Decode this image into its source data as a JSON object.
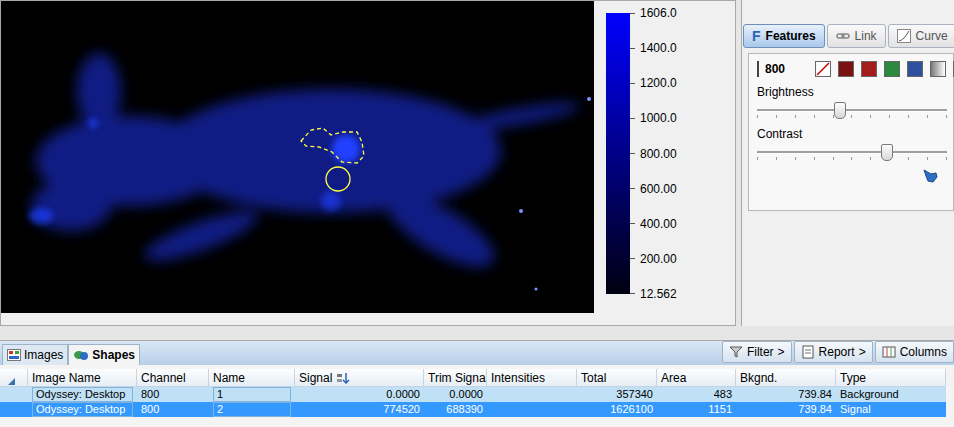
{
  "viewer": {
    "scale": {
      "labels": [
        "1606.0",
        "1400.0",
        "1200.0",
        "1000.0",
        "800.00",
        "600.00",
        "400.00",
        "200.00",
        "12.562"
      ]
    },
    "rois": [
      {
        "kind": "circle",
        "selected": false
      },
      {
        "kind": "freehand",
        "selected": true
      }
    ]
  },
  "features_panel": {
    "tabs": [
      {
        "label": "Features",
        "icon_text": "F",
        "selected": true
      },
      {
        "label": "Link",
        "selected": false
      },
      {
        "label": "Curve",
        "selected": false
      }
    ],
    "channel": {
      "label": "800",
      "color": "#2b3f8f"
    },
    "swatches": [
      {
        "kind": "none",
        "color": "#ffffff"
      },
      {
        "kind": "color",
        "color": "#7a1212"
      },
      {
        "kind": "color",
        "color": "#a51c1c"
      },
      {
        "kind": "color",
        "color": "#2b8a3e"
      },
      {
        "kind": "color",
        "color": "#2f4f9f"
      },
      {
        "kind": "color",
        "color": "#7a7a7a"
      },
      {
        "kind": "color",
        "color": "#d8d8d8"
      }
    ],
    "sliders": [
      {
        "label": "Brightness",
        "level": 0.43
      },
      {
        "label": "Contrast",
        "level": 0.68
      }
    ]
  },
  "bottom_tabs": [
    {
      "label": "Images",
      "selected": false
    },
    {
      "label": "Shapes",
      "selected": true
    }
  ],
  "toolbar": [
    {
      "label": "Filter",
      "arrow": ">"
    },
    {
      "label": "Report",
      "arrow": ">"
    },
    {
      "label": "Columns"
    }
  ],
  "table": {
    "columns": [
      {
        "label": "",
        "sorted": false
      },
      {
        "label": "Image Name",
        "sorted": false
      },
      {
        "label": "Channel",
        "sorted": false
      },
      {
        "label": "Name",
        "sorted": false
      },
      {
        "label": "Signal",
        "sorted": true
      },
      {
        "label": "Trim Signal",
        "sorted": false
      },
      {
        "label": "Intensities",
        "sorted": false
      },
      {
        "label": "Total",
        "sorted": false
      },
      {
        "label": "Area",
        "sorted": false
      },
      {
        "label": "Bkgnd.",
        "sorted": false
      },
      {
        "label": "Type",
        "sorted": false
      }
    ],
    "rows": [
      {
        "cells": [
          "Odyssey: Desktop",
          "800",
          "1",
          "0.0000",
          "0.0000",
          "",
          "357340",
          "483",
          "739.84",
          "Background"
        ],
        "selected": false
      },
      {
        "cells": [
          "Odyssey: Desktop",
          "800",
          "2",
          "774520",
          "688390",
          "",
          "1626100",
          "1151",
          "739.84",
          "Signal"
        ],
        "selected": true
      }
    ]
  }
}
